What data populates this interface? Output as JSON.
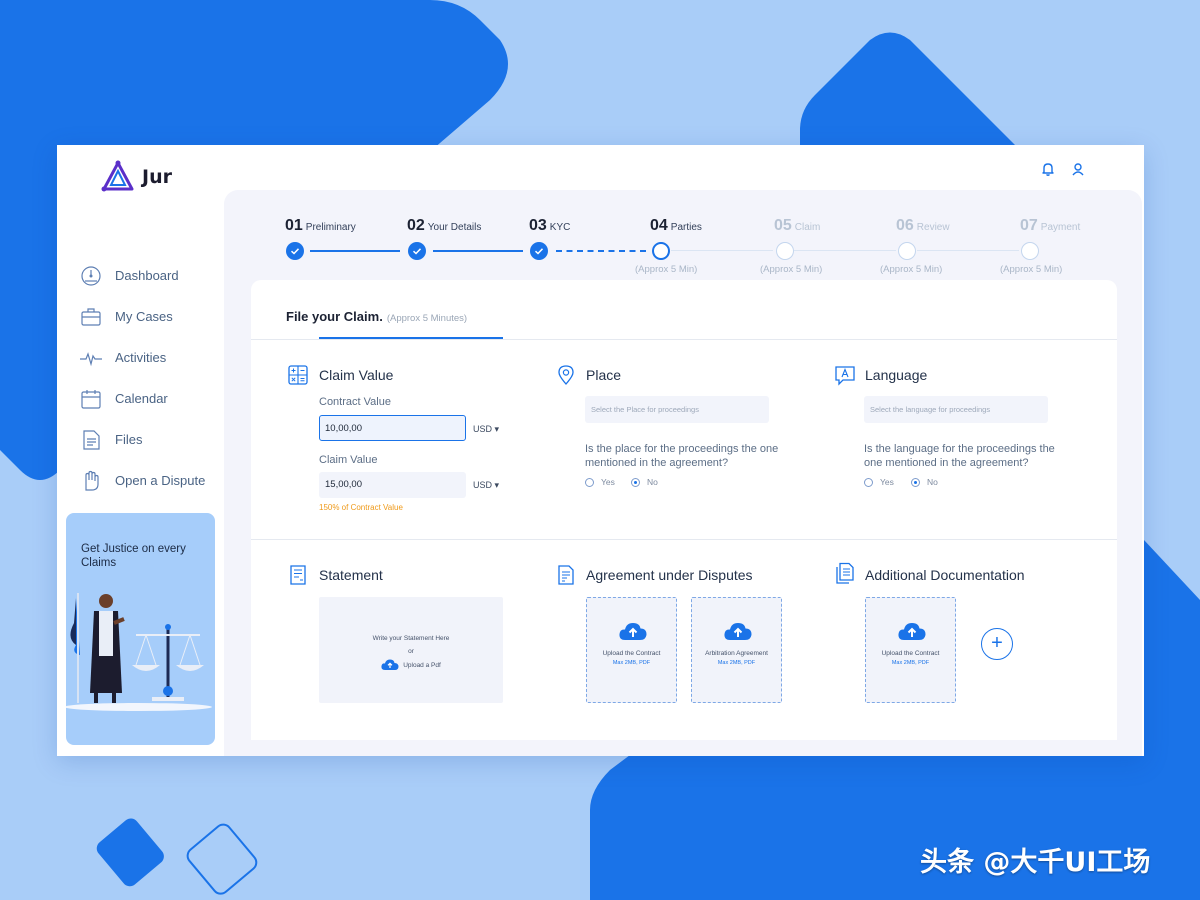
{
  "app": {
    "name": "Jur"
  },
  "colors": {
    "accent": "#1a73e8",
    "background": "#a9cdf8",
    "warning": "#ef9a1a"
  },
  "topbar": {
    "icons": [
      "bell-icon",
      "user-icon"
    ]
  },
  "sidebar": {
    "items": [
      {
        "label": "Dashboard",
        "icon": "dashboard-gauge-icon"
      },
      {
        "label": "My Cases",
        "icon": "briefcase-icon"
      },
      {
        "label": "Activities",
        "icon": "pulse-icon"
      },
      {
        "label": "Calendar",
        "icon": "calendar-icon"
      },
      {
        "label": "Files",
        "icon": "file-icon"
      },
      {
        "label": "Open a Dispute",
        "icon": "raised-hand-icon"
      }
    ],
    "promo": {
      "text": "Get Justice on every Claims"
    }
  },
  "stepper": {
    "steps": [
      {
        "num": "01",
        "name": "Preliminary",
        "state": "done",
        "sub": ""
      },
      {
        "num": "02",
        "name": "Your Details",
        "state": "done",
        "sub": ""
      },
      {
        "num": "03",
        "name": "KYC",
        "state": "done",
        "sub": ""
      },
      {
        "num": "04",
        "name": "Parties",
        "state": "current",
        "sub": "(Approx 5 Min)"
      },
      {
        "num": "05",
        "name": "Claim",
        "state": "pending",
        "sub": "(Approx 5 Min)"
      },
      {
        "num": "06",
        "name": "Review",
        "state": "pending",
        "sub": "(Approx 5 Min)"
      },
      {
        "num": "07",
        "name": "Payment",
        "state": "pending",
        "sub": "(Approx 5 Min)"
      }
    ]
  },
  "card": {
    "title": "File your Claim.",
    "subtitle": "(Approx 5 Minutes)",
    "claim": {
      "title": "Claim Value",
      "contract_label": "Contract Value",
      "contract_value": "10,00,00",
      "contract_currency": "USD",
      "claim_label": "Claim Value",
      "claim_value": "15,00,00",
      "claim_currency": "USD",
      "hint": "150% of Contract Value"
    },
    "place": {
      "title": "Place",
      "placeholder": "Select the Place for proceedings",
      "question": "Is the place for the proceedings the one mentioned in the agreement?",
      "yes": "Yes",
      "no": "No",
      "selected": "No"
    },
    "language": {
      "title": "Language",
      "placeholder": "Select the language for proceedings",
      "question": "Is the language for the proceedings the one mentioned in the agreement?",
      "yes": "Yes",
      "no": "No",
      "selected": "No"
    },
    "statement": {
      "title": "Statement",
      "line1": "Write your Statement Here",
      "or": "or",
      "upload": "Upload a Pdf"
    },
    "agreement": {
      "title": "Agreement under Disputes",
      "boxes": [
        {
          "title": "Upload the Contract",
          "sub": "Max 2MB, PDF"
        },
        {
          "title": "Arbitration Agreement",
          "sub": "Max 2MB, PDF"
        }
      ]
    },
    "additional": {
      "title": "Additional Documentation",
      "boxes": [
        {
          "title": "Upload the Contract",
          "sub": "Max 2MB, PDF"
        }
      ],
      "add_label": "+"
    }
  },
  "watermark": "头条 @大千UI工场"
}
